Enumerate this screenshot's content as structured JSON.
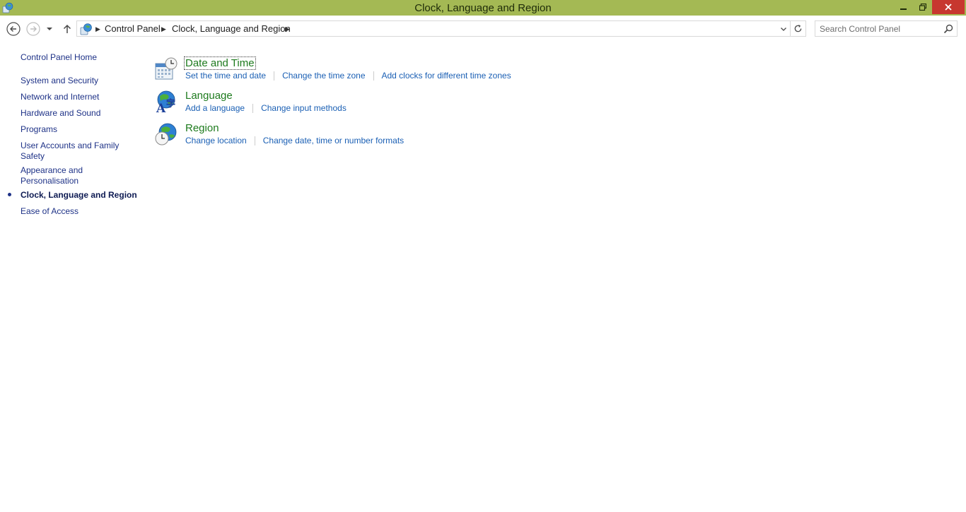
{
  "window": {
    "title": "Clock, Language and Region",
    "accent_color": "#a4b954",
    "close_color": "#c7372f"
  },
  "address": {
    "breadcrumbs": [
      "Control Panel",
      "Clock, Language and Region"
    ],
    "search_placeholder": "Search Control Panel"
  },
  "sidebar": {
    "home": "Control Panel Home",
    "items": [
      {
        "label": "System and Security"
      },
      {
        "label": "Network and Internet"
      },
      {
        "label": "Hardware and Sound"
      },
      {
        "label": "Programs"
      },
      {
        "label": "User Accounts and Family Safety"
      },
      {
        "label": "Appearance and Personalisation"
      },
      {
        "label": "Clock, Language and Region",
        "current": true
      },
      {
        "label": "Ease of Access"
      }
    ]
  },
  "categories": [
    {
      "title": "Date and Time",
      "icon": "calendar-clock-icon",
      "links": [
        "Set the time and date",
        "Change the time zone",
        "Add clocks for different time zones"
      ]
    },
    {
      "title": "Language",
      "icon": "language-globe-icon",
      "links": [
        "Add a language",
        "Change input methods"
      ]
    },
    {
      "title": "Region",
      "icon": "region-globe-clock-icon",
      "links": [
        "Change location",
        "Change date, time or number formats"
      ]
    }
  ]
}
